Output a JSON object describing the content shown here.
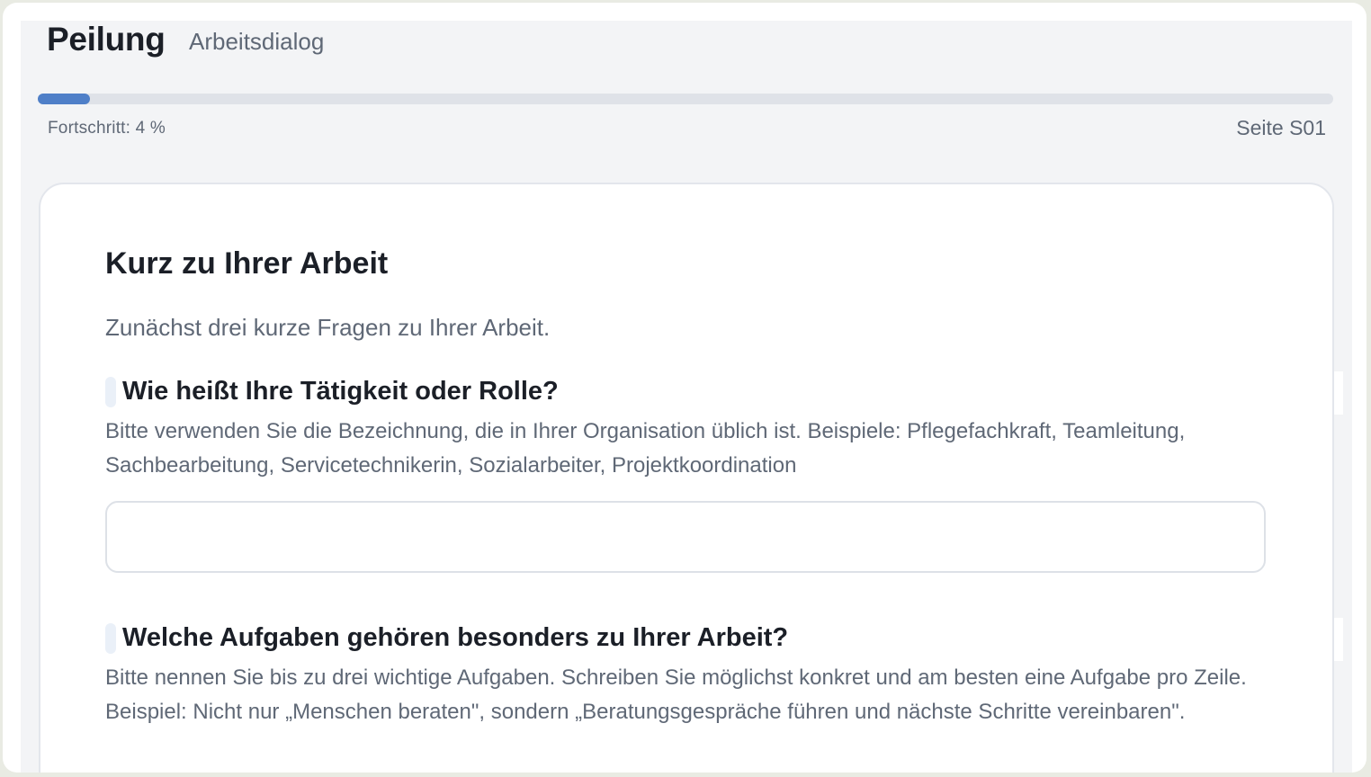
{
  "header": {
    "title": "Peilung",
    "subtitle": "Arbeitsdialog"
  },
  "progress": {
    "label": "Fortschritt: 4 %",
    "percent": 4,
    "page": "Seite S01",
    "color": "#4f7fc8"
  },
  "section": {
    "heading": "Kurz zu Ihrer Arbeit",
    "intro": "Zunächst drei kurze Fragen zu Ihrer Arbeit."
  },
  "questions": [
    {
      "label": "Wie heißt Ihre Tätigkeit oder Rolle?",
      "hint": "Bitte verwenden Sie die Bezeichnung, die in Ihrer Organisation üblich ist. Beispiele: Pflegefachkraft, Teamleitung, Sachbearbeitung, Servicetechnikerin, Sozialarbeiter, Projektkoordination",
      "value": ""
    },
    {
      "label": "Welche Aufgaben gehören besonders zu Ihrer Arbeit?",
      "hint": "Bitte nennen Sie bis zu drei wichtige Aufgaben. Schreiben Sie möglichst konkret und am besten eine Aufgabe pro Zeile. Beispiel: Nicht nur „Menschen beraten\", sondern „Beratungsgespräche führen und nächste Schritte vereinbaren\"."
    }
  ]
}
